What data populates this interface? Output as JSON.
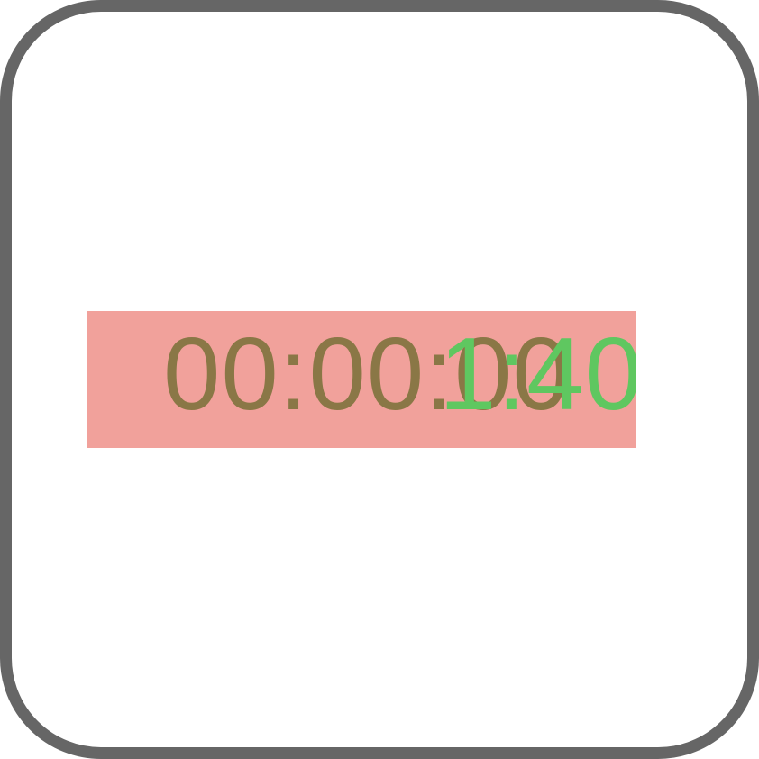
{
  "timer": {
    "base_text": "00:00:00",
    "overlay_text": "1:40",
    "colors": {
      "bar": "#f1a19b",
      "base_text": "#8a7746",
      "overlay_text": "#5fc760",
      "frame_border": "#666666"
    }
  }
}
